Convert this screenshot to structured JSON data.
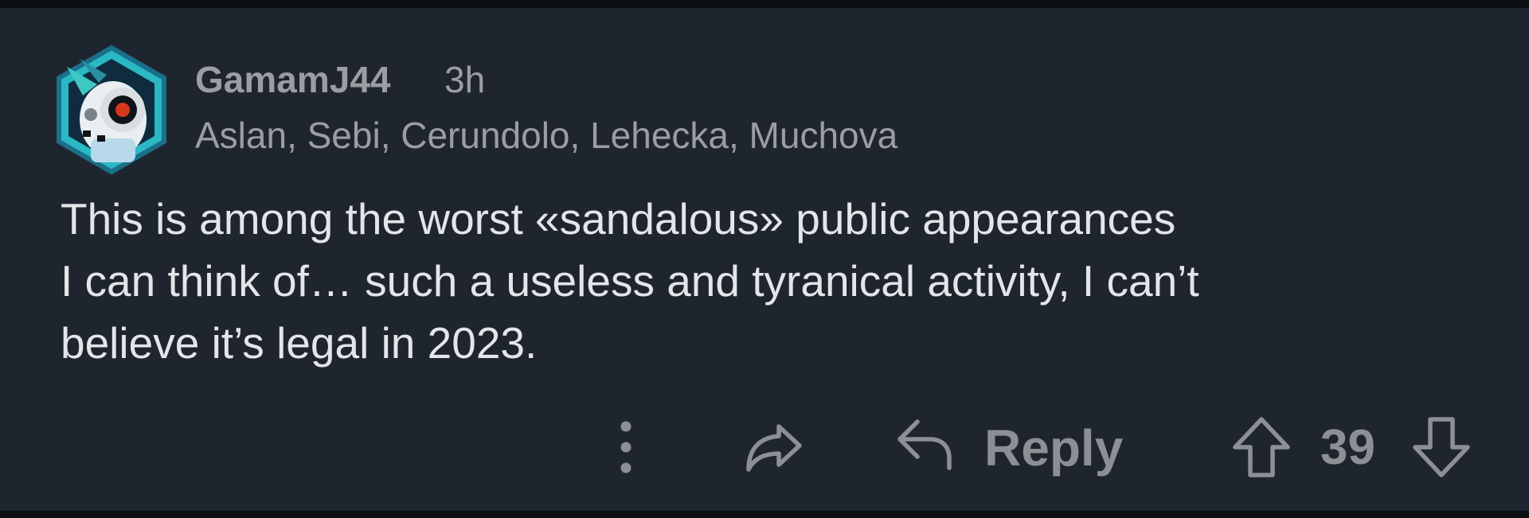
{
  "comment": {
    "username": "GamamJ44",
    "timestamp": "3h",
    "flair": "Aslan, Sebi, Cerundolo, Lehecka, Muchova",
    "body_lines": [
      "This is among the worst «sandalous» public appearances",
      "I can think of… such a useless and tyranical activity, I can’t",
      "believe it’s legal in 2023."
    ],
    "avatar_icon": "robot-avatar-icon"
  },
  "actions": {
    "more_icon": "vertical-dots-icon",
    "share_icon": "share-arrow-icon",
    "reply_icon": "reply-arrow-icon",
    "reply_label": "Reply",
    "upvote_icon": "upvote-arrow-icon",
    "score": "39",
    "downvote_icon": "downvote-arrow-icon"
  },
  "colors": {
    "background": "#1f252e",
    "muted_text": "#9a9ea3",
    "body_text": "#e3e5e8",
    "action_gray": "#8c9095",
    "avatar_accent": "#2ab8c4"
  }
}
